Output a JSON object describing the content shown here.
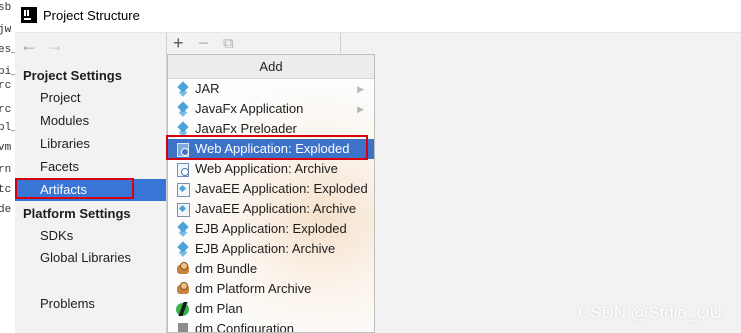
{
  "window": {
    "title": "Project Structure"
  },
  "background_strip": [
    "sb",
    "jw",
    "es_",
    "pi_s",
    "rc",
    "rc",
    "pl_",
    "vm",
    "rn",
    "tc",
    "de"
  ],
  "nav": {
    "back_label": "←",
    "forward_label": "→"
  },
  "left_panel": {
    "project_settings_header": "Project Settings",
    "project_settings_items": [
      "Project",
      "Modules",
      "Libraries",
      "Facets",
      "Artifacts"
    ],
    "selected_item": "Artifacts",
    "platform_settings_header": "Platform Settings",
    "platform_settings_items": [
      "SDKs",
      "Global Libraries"
    ],
    "problems_label": "Problems"
  },
  "toolbar": {
    "add_icon": "+",
    "remove_icon": "−",
    "copy_icon": "⧉"
  },
  "popup": {
    "header": "Add",
    "items": [
      {
        "label": "JAR",
        "icon": "jar-icon",
        "submenu": true
      },
      {
        "label": "JavaFx Application",
        "icon": "javafx-icon",
        "submenu": true
      },
      {
        "label": "JavaFx Preloader",
        "icon": "javafx-icon",
        "submenu": false
      },
      {
        "label": "Web Application: Exploded",
        "icon": "web-app-icon",
        "submenu": false,
        "selected": true
      },
      {
        "label": "Web Application: Archive",
        "icon": "web-app-icon",
        "submenu": false
      },
      {
        "label": "JavaEE Application: Exploded",
        "icon": "javaee-icon",
        "submenu": false
      },
      {
        "label": "JavaEE Application: Archive",
        "icon": "javaee-icon",
        "submenu": false
      },
      {
        "label": "EJB Application: Exploded",
        "icon": "ejb-icon",
        "submenu": false
      },
      {
        "label": "EJB Application: Archive",
        "icon": "ejb-icon",
        "submenu": false
      },
      {
        "label": "dm Bundle",
        "icon": "dm-bundle-icon",
        "submenu": false
      },
      {
        "label": "dm Platform Archive",
        "icon": "dm-platform-icon",
        "submenu": false
      },
      {
        "label": "dm Plan",
        "icon": "dm-plan-icon",
        "submenu": false
      },
      {
        "label": "dm Configuration",
        "icon": "dm-config-icon",
        "submenu": false
      }
    ],
    "submenu_arrow": "▶"
  },
  "watermark": "CSDN @Stdio_QU",
  "colors": {
    "selection": "#3875d7",
    "highlight_box": "#d6000f",
    "popup_selection": "#3d72c9"
  }
}
